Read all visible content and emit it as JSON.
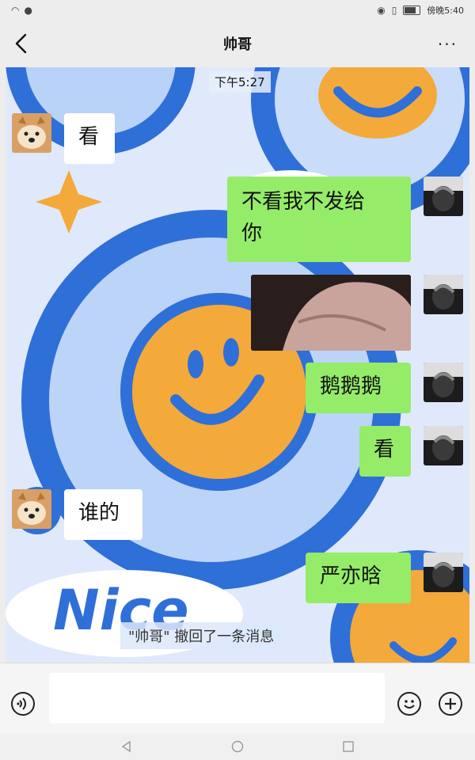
{
  "header": {
    "title": "帅哥",
    "back_icon": "chevron-left-icon",
    "more_icon": "more-icon",
    "more_label": "···"
  },
  "status_bar": {
    "clock": "傍晚5:40"
  },
  "chat": {
    "timestamp": "下午5:27",
    "messages": [
      {
        "side": "in",
        "text": "看"
      },
      {
        "side": "out",
        "text_line1": "不看我不发给",
        "text_line2": "你"
      },
      {
        "side": "out",
        "type": "image"
      },
      {
        "side": "out",
        "text": "鹅鹅鹅"
      },
      {
        "side": "out",
        "text": "看"
      },
      {
        "side": "in",
        "text": "谁的"
      },
      {
        "side": "out",
        "text": "严亦晗"
      }
    ],
    "recall_notice": "\"帅哥\" 撤回了一条消息"
  },
  "colors": {
    "bubble_out": "#95ec69",
    "bubble_in": "#ffffff",
    "bg_blue": "#2f6fd8",
    "bg_orange": "#f4a93b"
  }
}
